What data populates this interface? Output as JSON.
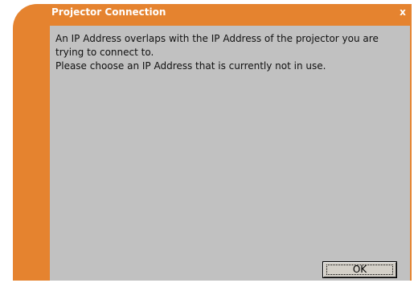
{
  "dialog": {
    "title": "Projector Connection",
    "close_label": "x",
    "message": {
      "line1": "An IP Address overlaps with the IP Address of the projector you are trying to connect to.",
      "line2": "Please choose an IP Address that is currently not in use."
    },
    "ok_label": "OK"
  },
  "colors": {
    "frame": "#e5832f",
    "content_bg": "#c1c1c1",
    "title_text": "#ffffff"
  },
  "icons": {
    "close": "close-icon"
  }
}
